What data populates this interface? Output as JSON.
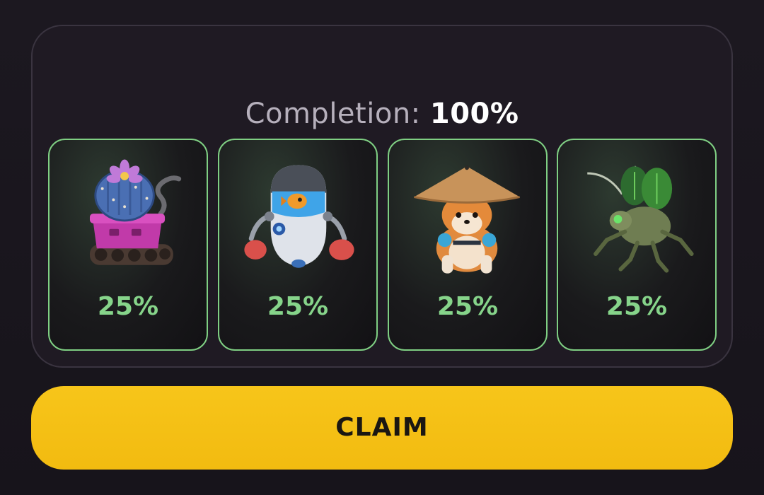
{
  "completion": {
    "label": "Completion:",
    "value": "100%"
  },
  "cards": [
    {
      "character": "cactus-tank",
      "percent": "25%",
      "icon": "cactus-tank-icon"
    },
    {
      "character": "fish-bowl-robot",
      "percent": "25%",
      "icon": "fish-robot-icon"
    },
    {
      "character": "shiba-dog",
      "percent": "25%",
      "icon": "shiba-dog-icon"
    },
    {
      "character": "mech-insect",
      "percent": "25%",
      "icon": "mech-insect-icon"
    }
  ],
  "claim_button": {
    "label": "CLAIM"
  },
  "colors": {
    "accent_yellow": "#f5c218",
    "card_border_green": "#7fcf83",
    "percent_green": "#86d48a",
    "background": "#1c1820"
  }
}
